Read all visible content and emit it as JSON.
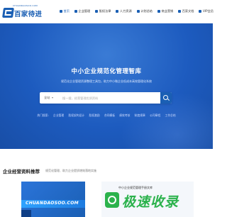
{
  "logo": {
    "sub": "CHUANDAOSOO.COM",
    "name": "百家待进"
  },
  "nav": {
    "items": [
      {
        "label": "首页",
        "icon": "home-icon",
        "active": true
      },
      {
        "label": "企业管理",
        "icon": "building-icon",
        "active": false
      },
      {
        "label": "股权法律",
        "icon": "gavel-icon",
        "active": false
      },
      {
        "label": "人力资源",
        "icon": "people-icon",
        "active": false
      },
      {
        "label": "计划总结",
        "icon": "calendar-icon",
        "active": false
      },
      {
        "label": "商业营销",
        "icon": "chart-icon",
        "active": false
      },
      {
        "label": "百家文档",
        "icon": "document-icon",
        "active": false
      },
      {
        "label": "VIP会员",
        "icon": "crown-icon",
        "active": false
      }
    ]
  },
  "hero": {
    "title": "中小企业规范化管理智库",
    "subtitle": "规范化企业管理资源整理工具包，助力中小微企业低成本高效管理化系统",
    "search": {
      "category": "全站",
      "placeholder": "搜一搜，经营管理优质资料",
      "button_label": "搜索"
    },
    "hot": [
      "热门搜索:",
      "企业管理",
      "股权架构设计",
      "股权激励",
      "合同模板",
      "绩效考核",
      "制度规章",
      "公司章程",
      "工作总结"
    ]
  },
  "section": {
    "title": "企业经营资料推荐",
    "description": "规范化管理、助力企业提质增效落地实施",
    "card_left_text": "CHUANDAOSOO.COM",
    "card_right_title": "中小企业规范管理手册文库"
  },
  "watermark": {
    "text": "极速收录"
  },
  "colors": {
    "brand": "#1a5fb4",
    "hero": "#1d5bbf",
    "watermark": "#2bb24c"
  }
}
